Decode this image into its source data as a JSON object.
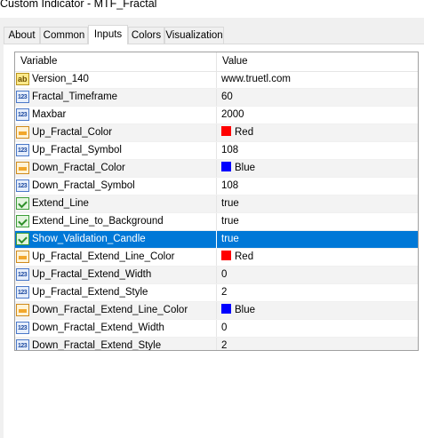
{
  "window": {
    "title": "Custom Indicator - MTF_Fractal"
  },
  "tabs": [
    {
      "label": "About"
    },
    {
      "label": "Common"
    },
    {
      "label": "Inputs",
      "active": true
    },
    {
      "label": "Colors"
    },
    {
      "label": "Visualization"
    }
  ],
  "grid": {
    "headers": {
      "variable": "Variable",
      "value": "Value"
    },
    "rows": [
      {
        "name": "Version_140",
        "value": "www.truetl.com",
        "icon": "text-type-icon"
      },
      {
        "name": "Fractal_Timeframe",
        "value": "60",
        "icon": "integer-type-icon"
      },
      {
        "name": "Maxbar",
        "value": "2000",
        "icon": "integer-type-icon"
      },
      {
        "name": "Up_Fractal_Color",
        "value": "Red",
        "icon": "color-type-icon",
        "swatch": "#ff0000"
      },
      {
        "name": "Up_Fractal_Symbol",
        "value": "108",
        "icon": "integer-type-icon"
      },
      {
        "name": "Down_Fractal_Color",
        "value": "Blue",
        "icon": "color-type-icon",
        "swatch": "#0000ff"
      },
      {
        "name": "Down_Fractal_Symbol",
        "value": "108",
        "icon": "integer-type-icon"
      },
      {
        "name": "Extend_Line",
        "value": "true",
        "icon": "boolean-type-icon"
      },
      {
        "name": "Extend_Line_to_Background",
        "value": "true",
        "icon": "boolean-type-icon"
      },
      {
        "name": "Show_Validation_Candle",
        "value": "true",
        "icon": "boolean-type-icon",
        "selected": true
      },
      {
        "name": "Up_Fractal_Extend_Line_Color",
        "value": "Red",
        "icon": "color-type-icon",
        "swatch": "#ff0000"
      },
      {
        "name": "Up_Fractal_Extend_Width",
        "value": "0",
        "icon": "integer-type-icon"
      },
      {
        "name": "Up_Fractal_Extend_Style",
        "value": "2",
        "icon": "integer-type-icon"
      },
      {
        "name": "Down_Fractal_Extend_Line_Color",
        "value": "Blue",
        "icon": "color-type-icon",
        "swatch": "#0000ff"
      },
      {
        "name": "Down_Fractal_Extend_Width",
        "value": "0",
        "icon": "integer-type-icon"
      },
      {
        "name": "Down_Fractal_Extend_Style",
        "value": "2",
        "icon": "integer-type-icon"
      }
    ]
  }
}
